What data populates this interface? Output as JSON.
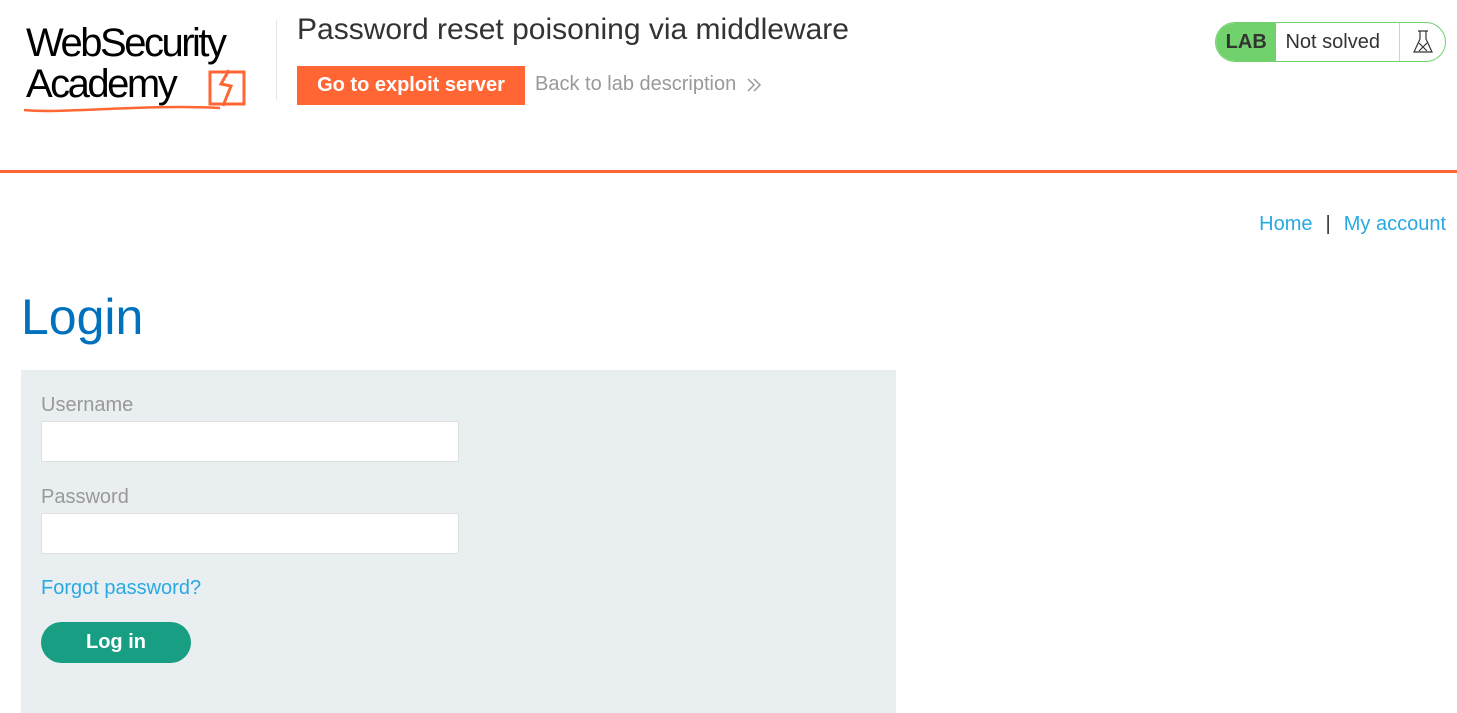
{
  "logo": {
    "line1": "WebSecurity",
    "line2": "Academy"
  },
  "header": {
    "lab_title": "Password reset poisoning via middleware",
    "exploit_button_label": "Go to exploit server",
    "back_link_label": "Back to lab description"
  },
  "lab_status": {
    "tag": "LAB",
    "state": "Not solved",
    "icon": "flask-icon"
  },
  "nav": {
    "home": "Home",
    "separator": "|",
    "my_account": "My account"
  },
  "page": {
    "title": "Login"
  },
  "login_form": {
    "username_label": "Username",
    "username_value": "",
    "password_label": "Password",
    "password_value": "",
    "forgot_password_link": "Forgot password?",
    "submit_label": "Log in"
  },
  "colors": {
    "brand_orange": "#ff6633",
    "lab_green": "#70d16d",
    "link_blue": "#29a9e1",
    "title_blue": "#0071bc",
    "button_teal": "#189e83",
    "panel_bg": "#e9eef1"
  }
}
